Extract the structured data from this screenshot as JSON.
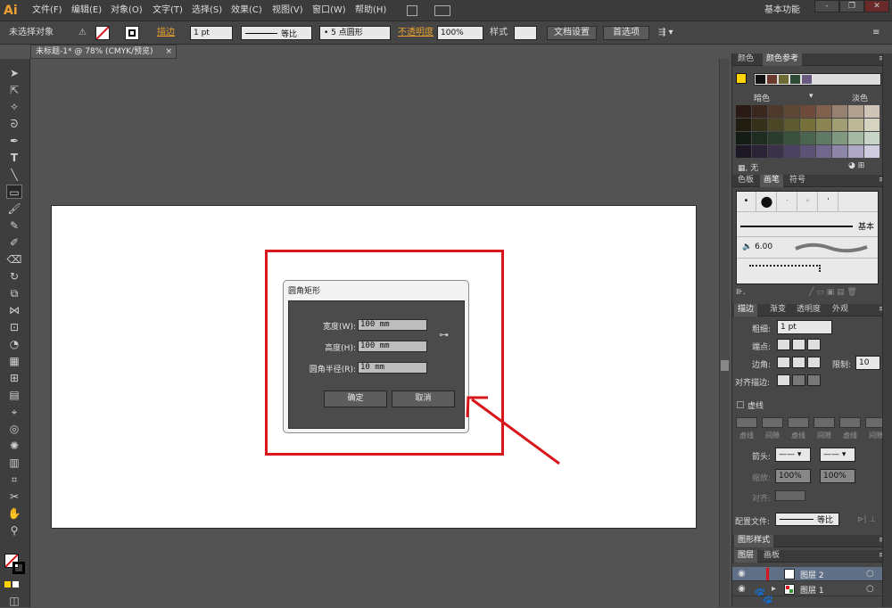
{
  "app": {
    "logo": "Ai",
    "workspace": "基本功能",
    "window_buttons": [
      "-",
      "❐",
      "✕"
    ]
  },
  "menu": [
    "文件(F)",
    "编辑(E)",
    "对象(O)",
    "文字(T)",
    "选择(S)",
    "效果(C)",
    "视图(V)",
    "窗口(W)",
    "帮助(H)"
  ],
  "control": {
    "selection": "未选择对象",
    "stroke_label": "描边",
    "stroke_value": "1 pt",
    "profile": "等比",
    "brush_def": "5 点圆形",
    "opacity_label": "不透明度",
    "opacity_value": "100%",
    "style_label": "样式",
    "doc_settings": "文档设置",
    "preferences": "首选项"
  },
  "doc_tab": {
    "title": "未标题-1* @ 78% (CMYK/预览)",
    "close": "×"
  },
  "dialog": {
    "title": "圆角矩形",
    "width_label": "宽度(W):",
    "width_value": "100 mm",
    "height_label": "高度(H):",
    "height_value": "100 mm",
    "radius_label": "圆角半径(R):",
    "radius_value": "10 mm",
    "ok": "确定",
    "cancel": "取消"
  },
  "panel_color": {
    "tabs": [
      "颜色",
      "颜色参考"
    ],
    "dark_label": "暗色",
    "light_label": "淡色",
    "none_label": "无"
  },
  "panel_brush": {
    "tabs": [
      "色板",
      "画笔",
      "符号"
    ],
    "basic_label": "基本",
    "size_label": "6.00"
  },
  "panel_stroke": {
    "tabs": [
      "描边",
      "渐变",
      "透明度",
      "外观"
    ],
    "weight_label": "粗细:",
    "weight_value": "1 pt",
    "cap_label": "端点:",
    "corner_label": "边角:",
    "limit_label": "限制:",
    "limit_value": "10",
    "align_label": "对齐描边:",
    "dashed_label": "虚线",
    "dash_labels": [
      "虚线",
      "间隙",
      "虚线",
      "间隙",
      "虚线",
      "间隙"
    ],
    "arrow_label": "箭头:",
    "scale_label": "缩放:",
    "scale_value1": "100%",
    "scale_value2": "100%",
    "align2_label": "对齐:",
    "profile_label": "配置文件:",
    "profile_value": "等比"
  },
  "panel_graphic_styles": {
    "title": "图形样式"
  },
  "panel_layers": {
    "tabs": [
      "图层",
      "画板"
    ],
    "layers": [
      "图层 2",
      "图层 1"
    ]
  },
  "colors": {
    "accent_red": "#d9161b",
    "menubar": "#3b3b3b",
    "canvas": "#ffffff"
  },
  "icons": {
    "arrow": "red-pointer-arrow"
  }
}
